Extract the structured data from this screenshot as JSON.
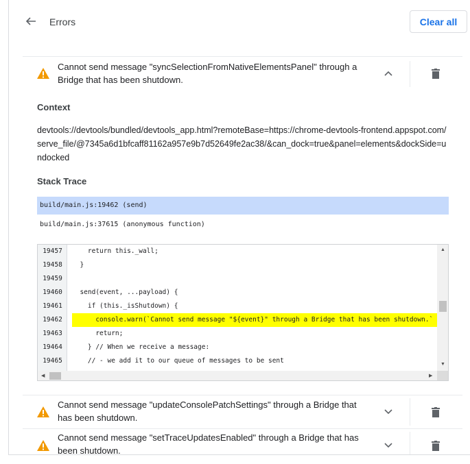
{
  "header": {
    "title": "Errors",
    "clear_label": "Clear all"
  },
  "colors": {
    "accent": "#1a73e8",
    "warning": "#f29900",
    "selected_frame": "#c6dafc",
    "highlight_line": "#ffff00"
  },
  "errors": [
    {
      "message": "Cannot send message \"syncSelectionFromNativeElementsPanel\" through a Bridge that has been shutdown.",
      "expanded": true
    },
    {
      "message": "Cannot send message \"updateConsolePatchSettings\" through a Bridge that has been shutdown.",
      "expanded": false
    },
    {
      "message": "Cannot send message \"setTraceUpdatesEnabled\" through a Bridge that has been shutdown.",
      "expanded": false
    }
  ],
  "details": {
    "context_heading": "Context",
    "context_text": "devtools://devtools/bundled/devtools_app.html?remoteBase=https://chrome-devtools-frontend.appspot.com/serve_file/@7345a6d1bfcaff81162a957e9b7d52649fe2ac38/&can_dock=true&panel=elements&dockSide=undocked",
    "stack_heading": "Stack Trace",
    "frames": [
      {
        "text": "build/main.js:19462 (send)",
        "selected": true
      },
      {
        "text": "build/main.js:37615 (anonymous function)",
        "selected": false
      }
    ]
  },
  "code": {
    "lines": [
      {
        "num": "19457",
        "text": "    return this._wall;",
        "highlight": false
      },
      {
        "num": "19458",
        "text": "  }",
        "highlight": false
      },
      {
        "num": "19459",
        "text": "",
        "highlight": false
      },
      {
        "num": "19460",
        "text": "  send(event, ...payload) {",
        "highlight": false
      },
      {
        "num": "19461",
        "text": "    if (this._isShutdown) {",
        "highlight": false
      },
      {
        "num": "19462",
        "text": "      console.warn(`Cannot send message \"${event}\" through a Bridge that has been shutdown.`",
        "highlight": true
      },
      {
        "num": "19463",
        "text": "      return;",
        "highlight": false
      },
      {
        "num": "19464",
        "text": "    } // When we receive a message:",
        "highlight": false
      },
      {
        "num": "19465",
        "text": "    // - we add it to our queue of messages to be sent",
        "highlight": false
      }
    ]
  },
  "icons": {
    "back": "arrow-left-icon",
    "warning": "warning-icon",
    "collapse": "chevron-up-icon",
    "expand": "chevron-down-icon",
    "delete": "trash-icon"
  }
}
